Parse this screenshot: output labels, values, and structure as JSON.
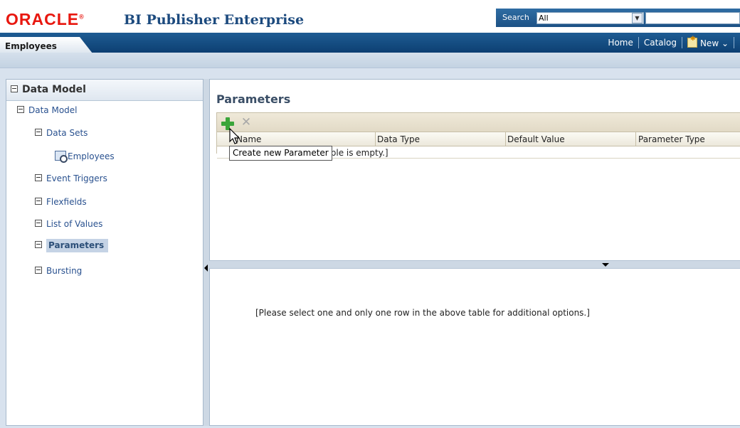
{
  "header": {
    "brand": "ORACLE",
    "brand_mark": "®",
    "product": "BI Publisher Enterprise",
    "search_label": "Search",
    "search_scope": "All",
    "search_value": ""
  },
  "nav": {
    "active_tab": "Employees",
    "links": {
      "home": "Home",
      "catalog": "Catalog",
      "new": "New ⌄"
    }
  },
  "left_panel": {
    "title": "Data Model",
    "tree": {
      "root": "Data Model",
      "data_sets": "Data Sets",
      "employees": "Employees",
      "event_triggers": "Event Triggers",
      "flexfields": "Flexfields",
      "list_of_values": "List of Values",
      "parameters": "Parameters",
      "bursting": "Bursting"
    },
    "selected": "Parameters"
  },
  "main": {
    "title": "Parameters",
    "table": {
      "columns": [
        "Name",
        "Data Type",
        "Default Value",
        "Parameter Type"
      ],
      "empty_text": "[No data to display. Table is empty.]",
      "visible_empty_text": "mpty.]"
    },
    "tooltip": "Create new Parameter",
    "instruction": "[Please select one and only one row in the above table for additional options.]"
  },
  "icons": {
    "add": "plus-icon",
    "delete": "delete-x-icon",
    "employees": "dataset-icon",
    "new": "new-document-icon",
    "cursor": "mouse-pointer-icon"
  },
  "colors": {
    "brand_red": "#e8170f",
    "navbar_blue": "#1e5c93",
    "add_green": "#3aa53a"
  }
}
